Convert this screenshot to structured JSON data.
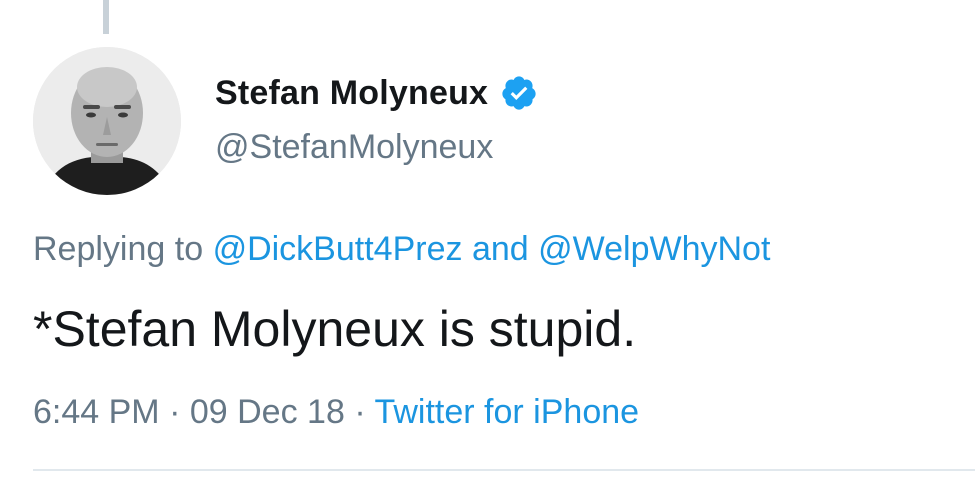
{
  "author": {
    "display_name": "Stefan Molyneux",
    "handle": "@StefanMolyneux",
    "verified": true
  },
  "reply": {
    "prefix": "Replying to",
    "mention_1": "@DickButt4Prez",
    "conjunction": "and",
    "mention_2": "@WelpWhyNot"
  },
  "tweet": {
    "text": "*Stefan Molyneux is stupid."
  },
  "meta": {
    "time": "6:44 PM",
    "separator_1": "·",
    "date": "09 Dec 18",
    "separator_2": "·",
    "source": "Twitter for iPhone"
  },
  "colors": {
    "link": "#1b95e0",
    "secondary_text": "#657786",
    "primary_text": "#14171a",
    "verified_badge": "#1da1f2"
  },
  "icons": {
    "verified": "verified-badge-icon",
    "avatar": "profile-photo"
  }
}
